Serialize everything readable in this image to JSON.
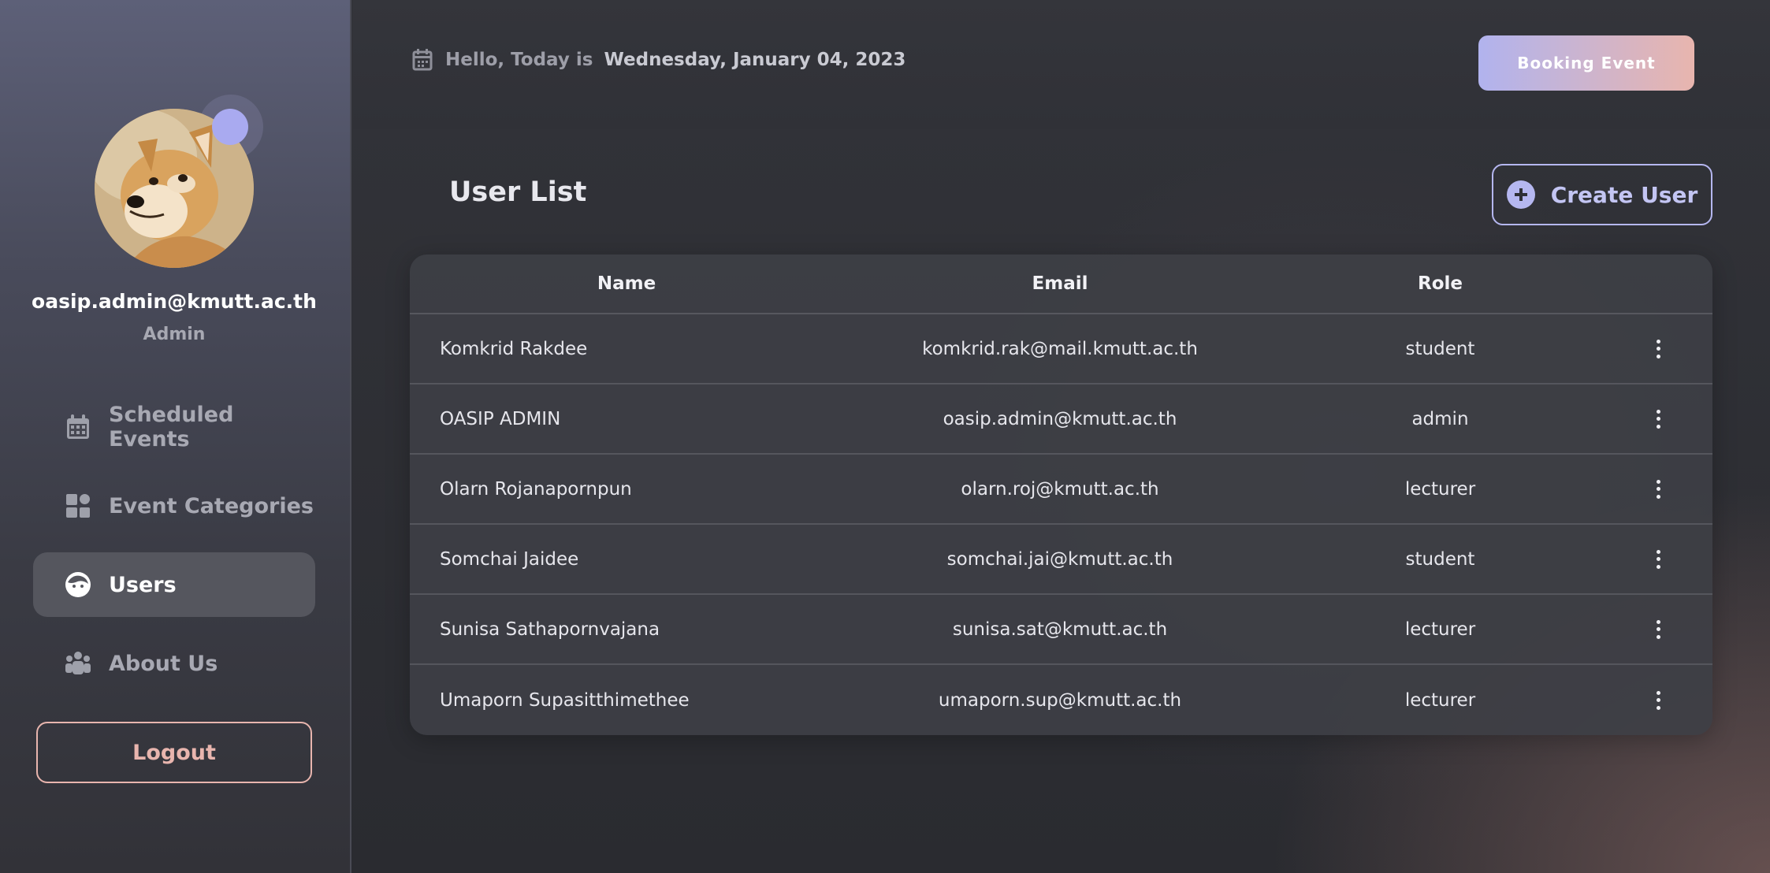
{
  "sidebar": {
    "user_email": "oasip.admin@kmutt.ac.th",
    "user_role": "Admin",
    "avatar_icon": "doge-avatar",
    "items": [
      {
        "label": "Scheduled Events",
        "icon": "calendar-icon",
        "active": false
      },
      {
        "label": "Event Categories",
        "icon": "grid-icon",
        "active": false
      },
      {
        "label": "Users",
        "icon": "user-face-icon",
        "active": true
      },
      {
        "label": "About Us",
        "icon": "group-icon",
        "active": false
      }
    ],
    "logout_label": "Logout"
  },
  "header": {
    "greeting": "Hello, Today is",
    "date": "Wednesday, January 04, 2023",
    "booking_label": "Booking Event"
  },
  "main": {
    "title": "User List",
    "create_label": "Create User",
    "table": {
      "columns": [
        "Name",
        "Email",
        "Role"
      ],
      "rows": [
        {
          "name": "Komkrid Rakdee",
          "email": "komkrid.rak@mail.kmutt.ac.th",
          "role": "student"
        },
        {
          "name": "OASIP ADMIN",
          "email": "oasip.admin@kmutt.ac.th",
          "role": "admin"
        },
        {
          "name": "Olarn Rojanapornpun",
          "email": "olarn.roj@kmutt.ac.th",
          "role": "lecturer"
        },
        {
          "name": "Somchai Jaidee",
          "email": "somchai.jai@kmutt.ac.th",
          "role": "student"
        },
        {
          "name": "Sunisa Sathapornvajana",
          "email": "sunisa.sat@kmutt.ac.th",
          "role": "lecturer"
        },
        {
          "name": "Umaporn Supasitthimethee",
          "email": "umaporn.sup@kmutt.ac.th",
          "role": "lecturer"
        }
      ]
    }
  },
  "colors": {
    "accent": "#b1b3ee",
    "accent_warm": "#e8b5ae",
    "sidebar_top": "#5d6078",
    "background": "#2b2c31"
  }
}
